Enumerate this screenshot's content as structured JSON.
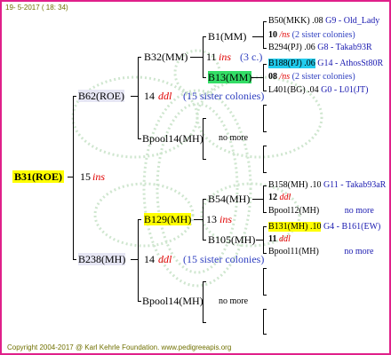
{
  "header": "19- 5-2017 ( 18: 34)",
  "footer": "Copyright 2004-2017 @ Karl Kehrle Foundation.   www.pedigreeapis.org",
  "root": {
    "name": "B31(ROE)",
    "num": "15",
    "code": "ins"
  },
  "p1": {
    "name": "B62(ROE)",
    "num": "14",
    "code": "ddl",
    "note": "(15 sister colonies)"
  },
  "p2": {
    "name": "B238(MH)",
    "num": "14",
    "code": "ddl",
    "note": "(15 sister colonies)"
  },
  "g1": {
    "name": "B32(MM)"
  },
  "g2": {
    "name": "Bpool14(MH)",
    "note": "no more"
  },
  "g3": {
    "name": "B129(MH)",
    "num": "13",
    "code": "ins"
  },
  "g4": {
    "name": "Bpool14(MH)",
    "note": "no more"
  },
  "gg1": {
    "name": "B1(MM)"
  },
  "gg1b": {
    "num": "11",
    "code": "ins",
    "note": "(3 c.)"
  },
  "gg2": {
    "name": "B13(MM)"
  },
  "gg3": {
    "name": "B54(MH)"
  },
  "gg4": {
    "name": "B105(MH)"
  },
  "l1": {
    "a": "B50(MKK)",
    "b": ".08",
    "c": "G9 - Old_Lady"
  },
  "l2": {
    "num": "10",
    "code": "/ns",
    "note": "(2 sister colonies)"
  },
  "l3": {
    "a": "B294(PJ)",
    "b": ".06",
    "c": "G8 - Takab93R"
  },
  "l4": {
    "a": "B188(PJ)",
    "b": ".06",
    "c": "G14 - AthosSt80R"
  },
  "l5": {
    "num": "08",
    "code": "/ns",
    "note": "(2 sister colonies)"
  },
  "l6": {
    "a": "L401(BG)",
    "b": ".04",
    "c": "G0 - L01(JT)"
  },
  "l7": {
    "a": "B158(MH)",
    "b": ".10",
    "c": "G11 - Takab93aR"
  },
  "l8": {
    "num": "12",
    "code": "ddl"
  },
  "l9": {
    "a": "Bpool12(MH)",
    "c": "no more"
  },
  "l10": {
    "a": "B131(MH)",
    "b": ".10",
    "c": "G4 - B161(EW)"
  },
  "l11": {
    "num": "11",
    "code": "ddl"
  },
  "l12": {
    "a": "Bpool11(MH)",
    "c": "no more"
  },
  "colors": {
    "border": "#e0208a",
    "yellow": "#ffff00",
    "green": "#33dd66",
    "cyan": "#22ccee",
    "code_red": "#e00000",
    "note_blue": "#3040c0"
  }
}
